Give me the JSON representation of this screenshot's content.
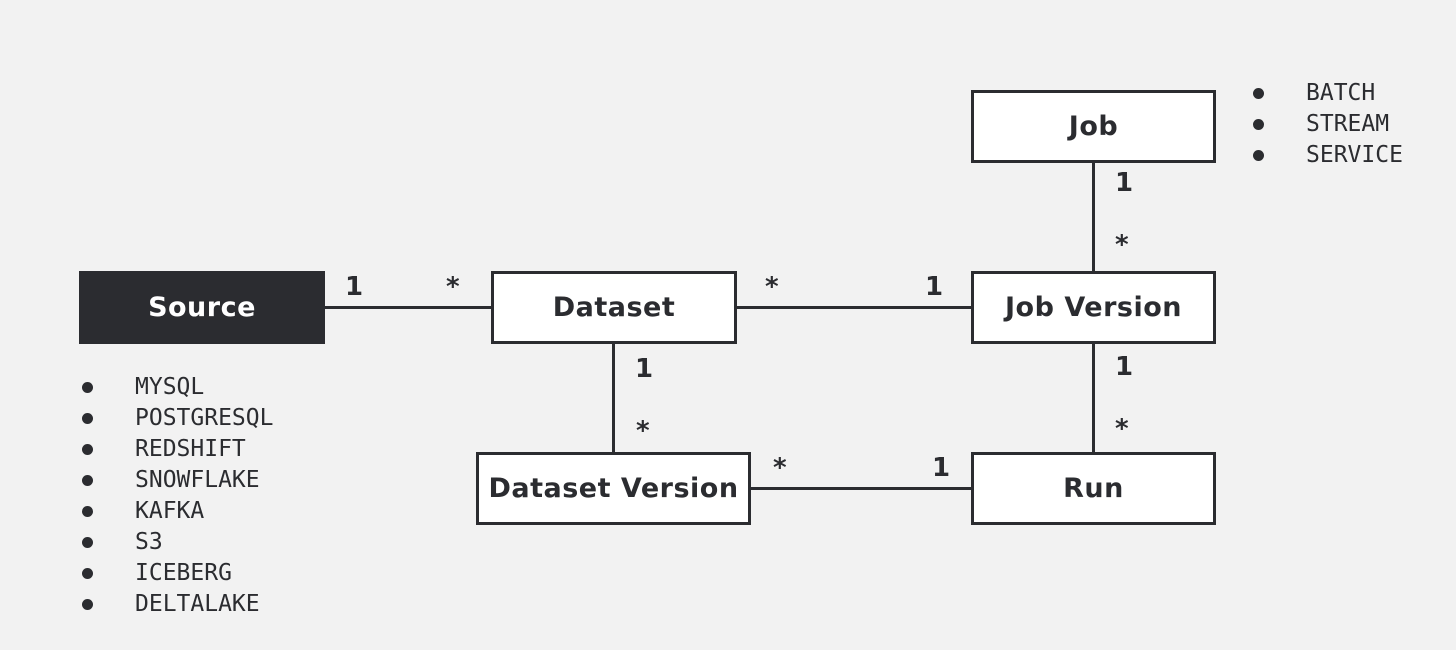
{
  "diagram": {
    "type": "entity-relationship",
    "entities": {
      "source": "Source",
      "dataset": "Dataset",
      "job": "Job",
      "job_version": "Job Version",
      "dataset_version": "Dataset Version",
      "run": "Run"
    },
    "relationships": [
      {
        "from": "Source",
        "to": "Dataset",
        "from_mult": "1",
        "to_mult": "*"
      },
      {
        "from": "Dataset",
        "to": "Job Version",
        "from_mult": "*",
        "to_mult": "1"
      },
      {
        "from": "Job",
        "to": "Job Version",
        "from_mult": "1",
        "to_mult": "*"
      },
      {
        "from": "Dataset",
        "to": "Dataset Version",
        "from_mult": "1",
        "to_mult": "*"
      },
      {
        "from": "Job Version",
        "to": "Run",
        "from_mult": "1",
        "to_mult": "*"
      },
      {
        "from": "Dataset Version",
        "to": "Run",
        "from_mult": "*",
        "to_mult": "1"
      }
    ],
    "source_types": [
      "MYSQL",
      "POSTGRESQL",
      "REDSHIFT",
      "SNOWFLAKE",
      "KAFKA",
      "S3",
      "ICEBERG",
      "DELTALAKE"
    ],
    "job_types": [
      "BATCH",
      "STREAM",
      "SERVICE"
    ],
    "colors": {
      "dark": "#2b2c30",
      "background": "#f2f2f2",
      "box_fill": "#ffffff"
    }
  }
}
